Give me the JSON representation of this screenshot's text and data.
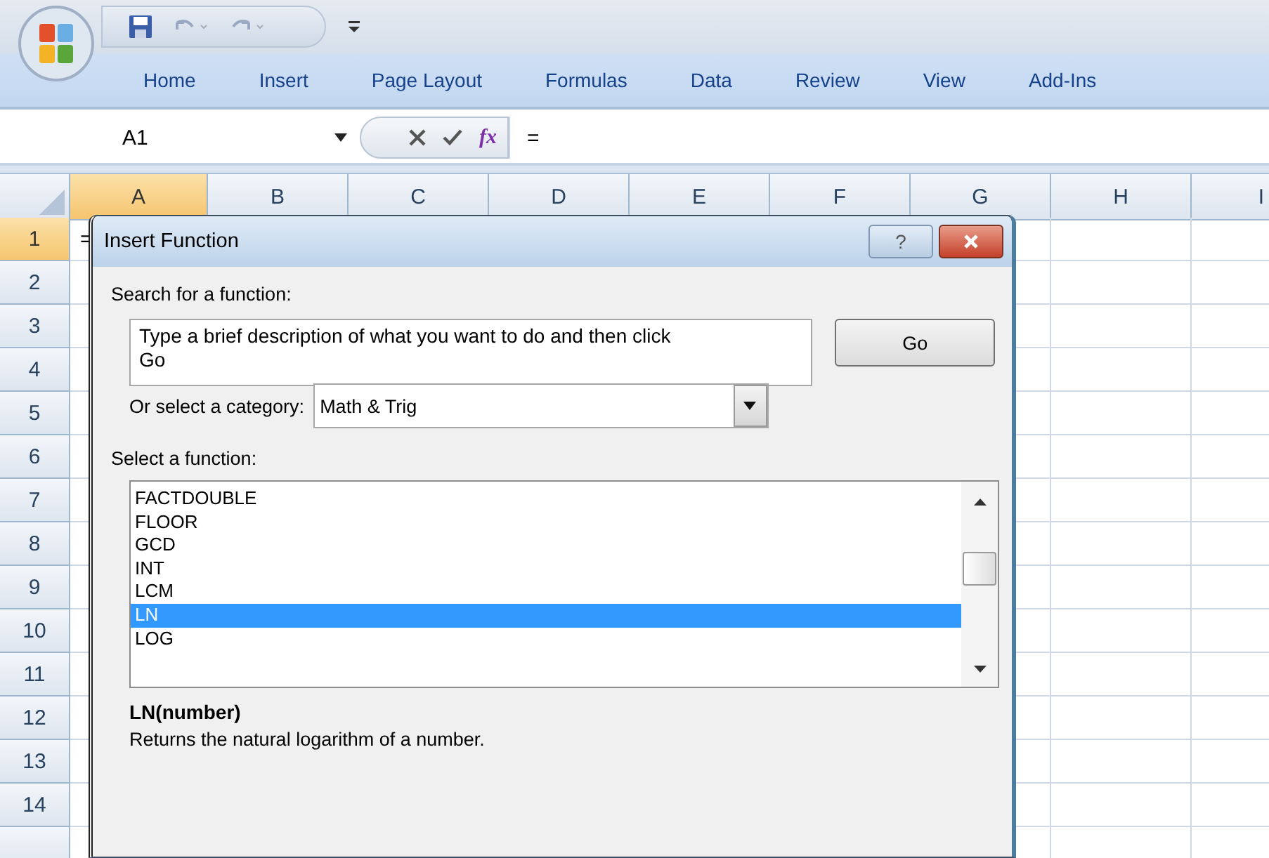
{
  "ribbon": {
    "tabs": [
      {
        "label": "Home"
      },
      {
        "label": "Insert"
      },
      {
        "label": "Page Layout"
      },
      {
        "label": "Formulas"
      },
      {
        "label": "Data"
      },
      {
        "label": "Review"
      },
      {
        "label": "View"
      },
      {
        "label": "Add-Ins"
      }
    ]
  },
  "formula_bar": {
    "name_box": "A1",
    "function_button": "fx",
    "formula": "="
  },
  "sheet": {
    "columns": [
      {
        "label": "A",
        "selected": true
      },
      {
        "label": "B",
        "selected": false
      },
      {
        "label": "C",
        "selected": false
      },
      {
        "label": "D",
        "selected": false
      },
      {
        "label": "E",
        "selected": false
      },
      {
        "label": "F",
        "selected": false
      },
      {
        "label": "G",
        "selected": false
      },
      {
        "label": "H",
        "selected": false
      },
      {
        "label": "I",
        "selected": false
      }
    ],
    "rows": [
      {
        "label": "1",
        "selected": true
      },
      {
        "label": "2",
        "selected": false
      },
      {
        "label": "3",
        "selected": false
      },
      {
        "label": "4",
        "selected": false
      },
      {
        "label": "5",
        "selected": false
      },
      {
        "label": "6",
        "selected": false
      },
      {
        "label": "7",
        "selected": false
      },
      {
        "label": "8",
        "selected": false
      },
      {
        "label": "9",
        "selected": false
      },
      {
        "label": "10",
        "selected": false
      },
      {
        "label": "11",
        "selected": false
      },
      {
        "label": "12",
        "selected": false
      },
      {
        "label": "13",
        "selected": false
      },
      {
        "label": "14",
        "selected": false
      }
    ],
    "active_cell": {
      "value": "="
    }
  },
  "dialog": {
    "title": "Insert Function",
    "help_button": "?",
    "search_label": "Search for a function:",
    "search_value": "Type a brief description of what you want to do and then click Go",
    "go_button": "Go",
    "category_label": "Or select a category:",
    "category_value": "Math & Trig",
    "function_label": "Select a function:",
    "functions": [
      {
        "name": "FACTDOUBLE",
        "selected": false
      },
      {
        "name": "FLOOR",
        "selected": false
      },
      {
        "name": "GCD",
        "selected": false
      },
      {
        "name": "INT",
        "selected": false
      },
      {
        "name": "LCM",
        "selected": false
      },
      {
        "name": "LN",
        "selected": true
      },
      {
        "name": "LOG",
        "selected": false
      }
    ],
    "signature": "LN(number)",
    "description": "Returns the natural logarithm of a number."
  }
}
